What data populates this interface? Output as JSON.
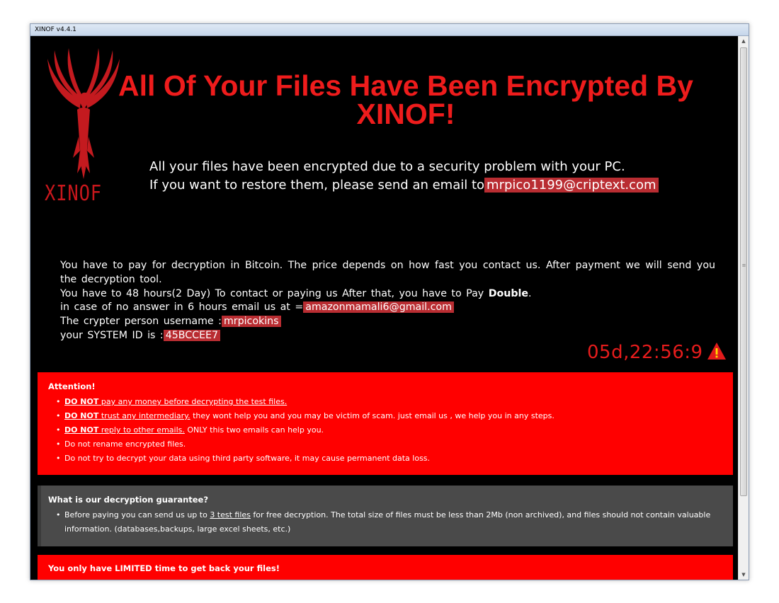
{
  "window": {
    "title": "XINOF v4.4.1"
  },
  "logo": {
    "text": "XINOF"
  },
  "headline": "All Of Your Files Have Been Encrypted By XINOF!",
  "intro": {
    "line1": "All your files have been encrypted due to a security problem with your PC.",
    "line2_prefix": "If you want to restore them, please send an email to",
    "email": "mrpico1199@criptext.com"
  },
  "details": {
    "p1": "You have to pay for decryption in Bitcoin. The price depends on how fast you contact us. After payment we will send you the decryption tool.",
    "p2_prefix": "You have to 48 hours(2 Day) To contact or paying us After that, you have to Pay",
    "p2_bold": "Double",
    "p2_suffix": ".",
    "p3_prefix": "in case of no answer in 6 hours email us at =",
    "p3_email": "amazonmamali6@gmail.com",
    "p4_prefix": "The crypter person username :",
    "p4_value": "mrpicokins",
    "p5_prefix": "your SYSTEM ID is :",
    "p5_value": "45BCCEE7"
  },
  "countdown": "05d,22:56:9",
  "attention": {
    "title": "Attention!",
    "items": [
      {
        "bold": "DO NOT",
        "link": " pay any money before decrypting the test files.",
        "rest": ""
      },
      {
        "bold": "DO NOT",
        "link": " trust any intermediary.",
        "rest": " they wont help you and you may be victim of scam. just email us , we help you in any steps."
      },
      {
        "bold": "DO NOT",
        "link": " reply to other emails.",
        "rest": " ONLY this two emails can help you."
      },
      {
        "bold": "",
        "link": "",
        "rest": "Do not rename encrypted files."
      },
      {
        "bold": "",
        "link": "",
        "rest": "Do not try to decrypt your data using third party software, it may cause permanent data loss."
      }
    ]
  },
  "guarantee": {
    "title": "What is our decryption guarantee?",
    "prefix": "Before paying you can send us up to ",
    "link": "3 test files",
    "suffix": " for free decryption. The total size of files must be less than 2Mb (non archived), and files should not contain valuable information. (databases,backups, large excel sheets, etc.)"
  },
  "limited": {
    "title": "You only have LIMITED time to get back your files!"
  },
  "colors": {
    "accent_red": "#ff0000",
    "headline_red": "#ee1c1c",
    "highlight": "#b92d32",
    "panel_grey": "#4a4a4a",
    "background": "#000000"
  }
}
